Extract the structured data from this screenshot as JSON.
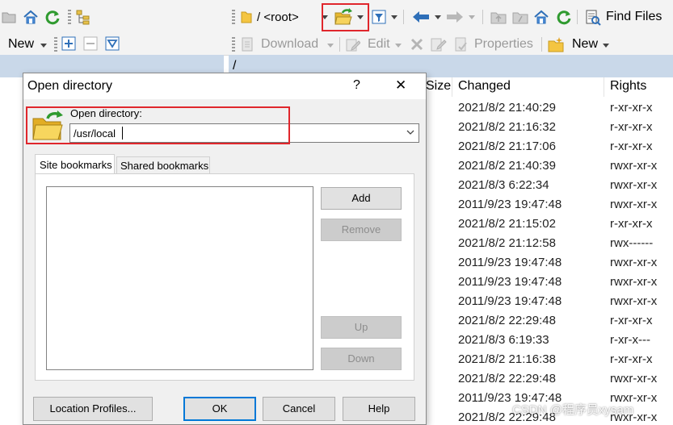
{
  "toolbar": {
    "path_label": "/ <root>",
    "find_files": "Find Files",
    "new_left": "New",
    "download": "Download",
    "edit": "Edit",
    "properties": "Properties",
    "new_right": "New"
  },
  "remote_panel": {
    "path": "/",
    "columns": {
      "size": "Size",
      "changed": "Changed",
      "rights": "Rights"
    },
    "rows": [
      {
        "changed": "2021/8/2 21:40:29",
        "rights": "r-xr-xr-x"
      },
      {
        "changed": "2021/8/2 21:16:32",
        "rights": "r-xr-xr-x"
      },
      {
        "changed": "2021/8/2 21:17:06",
        "rights": "r-xr-xr-x"
      },
      {
        "changed": "2021/8/2 21:40:39",
        "rights": "rwxr-xr-x"
      },
      {
        "changed": "2021/8/3 6:22:34",
        "rights": "rwxr-xr-x"
      },
      {
        "changed": "2011/9/23 19:47:48",
        "rights": "rwxr-xr-x"
      },
      {
        "changed": "2021/8/2 21:15:02",
        "rights": "r-xr-xr-x"
      },
      {
        "changed": "2021/8/2 21:12:58",
        "rights": "rwx------"
      },
      {
        "changed": "2011/9/23 19:47:48",
        "rights": "rwxr-xr-x"
      },
      {
        "changed": "2011/9/23 19:47:48",
        "rights": "rwxr-xr-x"
      },
      {
        "changed": "2011/9/23 19:47:48",
        "rights": "rwxr-xr-x"
      },
      {
        "changed": "2021/8/2 22:29:48",
        "rights": "r-xr-xr-x"
      },
      {
        "changed": "2021/8/3 6:19:33",
        "rights": "r-xr-x---"
      },
      {
        "changed": "2021/8/2 21:16:38",
        "rights": "r-xr-xr-x"
      },
      {
        "changed": "2021/8/2 22:29:48",
        "rights": "rwxr-xr-x"
      },
      {
        "changed": "2011/9/23 19:47:48",
        "rights": "rwxr-xr-x"
      },
      {
        "changed": "2021/8/2 22:29:48",
        "rights": "rwxr-xr-x"
      }
    ]
  },
  "watermark": "CSDN @程序员xysam",
  "dialog": {
    "title": "Open directory",
    "help_glyph": "?",
    "close_glyph": "✕",
    "open_dir_label": "Open directory:",
    "open_dir_value": "/usr/local",
    "tabs": [
      "Site bookmarks",
      "Shared bookmarks"
    ],
    "buttons": {
      "add": "Add",
      "remove": "Remove",
      "up": "Up",
      "down": "Down",
      "location_profiles": "Location Profiles...",
      "ok": "OK",
      "cancel": "Cancel",
      "help": "Help"
    }
  },
  "colors": {
    "highlight": "#e0262c",
    "path_bar": "#c9d8e9",
    "dialog_bg": "#f0f0f0",
    "folder": "#f4c542"
  }
}
